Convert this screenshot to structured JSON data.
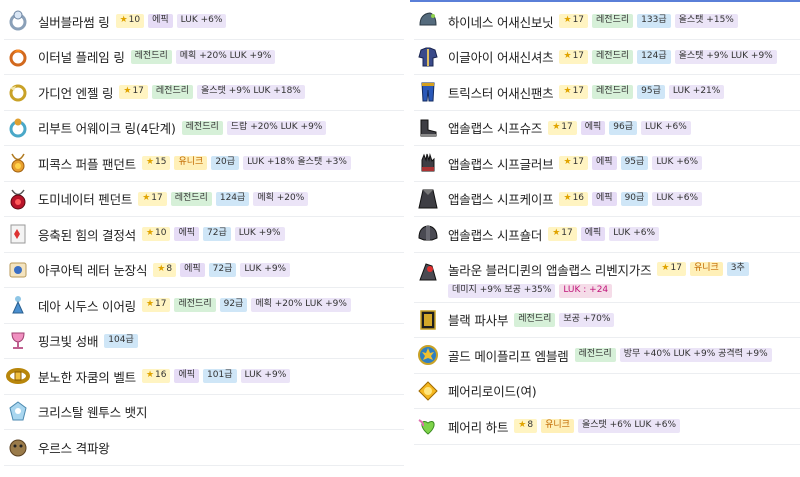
{
  "left": [
    {
      "icon": "silver-blossom-ring-icon",
      "name": "실버블라썸 링",
      "star": "10",
      "grade": "에픽",
      "tier": "",
      "opt": "LUK +6%"
    },
    {
      "icon": "eternal-flame-ring-icon",
      "name": "이터널 플레임 링",
      "star": "",
      "grade": "레전드리",
      "tier": "",
      "opt": "메획 +20% LUK +9%"
    },
    {
      "icon": "guardian-angel-ring-icon",
      "name": "가디언 엔젤 링",
      "star": "17",
      "grade": "레전드리",
      "tier": "",
      "opt": "올스탯 +9% LUK +18%"
    },
    {
      "icon": "reboot-awake-ring-icon",
      "name": "리부트 어웨이크 링(4단계)",
      "star": "",
      "grade": "레전드리",
      "tier": "",
      "opt": "드랍 +20% LUK +9%"
    },
    {
      "icon": "pink-bean-pendant-icon",
      "name": "피콕스 퍼플 팬던트",
      "star": "15",
      "grade": "유니크",
      "tier": "20급",
      "opt": "LUK +18% 올스탯 +3%"
    },
    {
      "icon": "dominator-pendant-icon",
      "name": "도미네이터 펜던트",
      "star": "17",
      "grade": "레전드리",
      "tier": "124급",
      "opt": "메획 +20%"
    },
    {
      "icon": "condensed-power-crystal-icon",
      "name": "응축된 힘의 결정석",
      "star": "10",
      "grade": "에픽",
      "tier": "72급",
      "opt": "LUK +9%"
    },
    {
      "icon": "aquatic-letter-eye-icon",
      "name": "아쿠아틱 레터 눈장식",
      "star": "8",
      "grade": "에픽",
      "tier": "72급",
      "opt": "LUK +9%"
    },
    {
      "icon": "dea-sidus-earring-icon",
      "name": "데아 시두스 이어링",
      "star": "17",
      "grade": "레전드리",
      "tier": "92급",
      "opt": "메획 +20% LUK +9%"
    },
    {
      "icon": "pink-holy-cup-icon",
      "name": "핑크빛 성배",
      "star": "",
      "grade": "",
      "tier": "104급",
      "opt": ""
    },
    {
      "icon": "enraged-zakum-belt-icon",
      "name": "분노한 자쿰의 벨트",
      "star": "16",
      "grade": "에픽",
      "tier": "101급",
      "opt": "LUK +9%"
    },
    {
      "icon": "crystal-ventus-badge-icon",
      "name": "크리스탈 웬투스 뱃지",
      "star": "",
      "grade": "",
      "tier": "",
      "opt": ""
    },
    {
      "icon": "ursus-medal-icon",
      "name": "우르스 격파왕",
      "star": "",
      "grade": "",
      "tier": "",
      "opt": ""
    }
  ],
  "right": [
    {
      "icon": "highness-assassin-hat-icon",
      "name": "하이네스 어새신보닛",
      "star": "17",
      "grade": "레전드리",
      "tier": "133급",
      "opt": "올스탯 +15%"
    },
    {
      "icon": "eagle-eye-assassin-shirt-icon",
      "name": "이글아이 어새신셔츠",
      "star": "17",
      "grade": "레전드리",
      "tier": "124급",
      "opt": "올스탯 +9% LUK +9%"
    },
    {
      "icon": "trickster-assassin-pants-icon",
      "name": "트릭스터 어새신팬츠",
      "star": "17",
      "grade": "레전드리",
      "tier": "95급",
      "opt": "LUK +21%"
    },
    {
      "icon": "absolab-shoes-icon",
      "name": "앱솔랩스 시프슈즈",
      "star": "17",
      "grade": "에픽",
      "tier": "96급",
      "opt": "LUK +6%"
    },
    {
      "icon": "absolab-glove-icon",
      "name": "앱솔랩스 시프글러브",
      "star": "17",
      "grade": "에픽",
      "tier": "95급",
      "opt": "LUK +6%"
    },
    {
      "icon": "absolab-cape-icon",
      "name": "앱솔랩스 시프케이프",
      "star": "16",
      "grade": "에픽",
      "tier": "90급",
      "opt": "LUK +6%"
    },
    {
      "icon": "absolab-shoulder-icon",
      "name": "앱솔랩스 시프숄더",
      "star": "17",
      "grade": "에픽",
      "tier": "",
      "opt": "LUK +6%"
    },
    {
      "icon": "bloody-queen-absolab-revenge-icon",
      "name": "놀라운 블러디퀸의 앱솔랩스 리벤지가즈",
      "star": "17",
      "grade": "유니크",
      "tier": "3추",
      "opt": "데미지 +9% 보공 +35%",
      "pot": "LUK : +24"
    },
    {
      "icon": "black-fafnir-icon",
      "name": "블랙 파사부",
      "star": "",
      "grade": "레전드리",
      "tier": "",
      "opt": "보공 +70%"
    },
    {
      "icon": "gold-maple-leaf-emblem-icon",
      "name": "골드 메이플리프 엠블렘",
      "star": "",
      "grade": "레전드리",
      "tier": "",
      "opt": "방무 +40% LUK +9% 공격력 +9%"
    },
    {
      "icon": "fairy-heart-android-icon",
      "name": "페어리로이드(여)",
      "star": "",
      "grade": "",
      "tier": "",
      "opt": ""
    },
    {
      "icon": "fairy-heart-icon",
      "name": "페어리 하트",
      "star": "8",
      "grade": "유니크",
      "tier": "",
      "opt": "올스탯 +6% LUK +6%"
    }
  ],
  "colors": {
    "accent_line": "#5a7fd8",
    "epic": "#e6dcf6",
    "legendary": "#d6f0d8",
    "unique": "#fff0b8",
    "star": "#fff4c2",
    "tier": "#cfe6f7",
    "option": "#ebe4f7",
    "potential": "#f5dce8"
  }
}
